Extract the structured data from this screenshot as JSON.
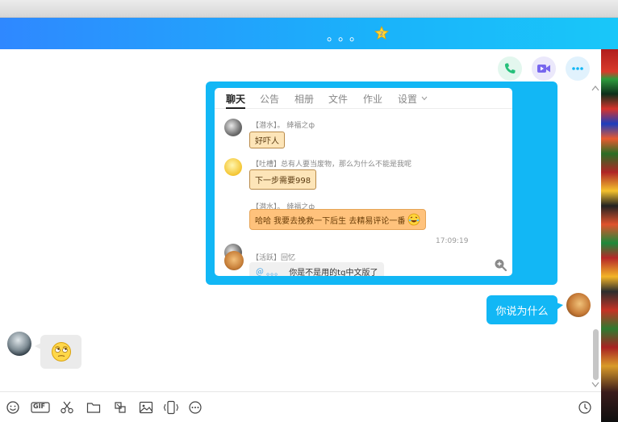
{
  "window": {
    "title": "。。。",
    "title_icon": "star-badge-icon",
    "accent": "#12b7f5",
    "titlebar_gradient": [
      "#2f88ff",
      "#19c7f9"
    ]
  },
  "header_actions": [
    {
      "name": "phone-call-button",
      "icon": "phone-icon",
      "color": "#27c07b"
    },
    {
      "name": "video-call-button",
      "icon": "video-camera-icon",
      "color": "#7766ee"
    },
    {
      "name": "more-options-button",
      "icon": "more-dots-icon",
      "color": "#12b7f5"
    }
  ],
  "shared_screenshot": {
    "tabs": [
      "聊天",
      "公告",
      "相册",
      "文件",
      "作业",
      "设置"
    ],
    "active_tab": "聊天",
    "messages": [
      {
        "sender": "【潜水】。 緈福之ф",
        "text": "好吓人",
        "style": "frame"
      },
      {
        "sender": "【吐槽】总有人要当废物，那么为什么不能是我呢",
        "text": "下一步需要998",
        "style": "frame"
      },
      {
        "sender": "【潜水】。 緈福之ф",
        "text": "哈哈  我要去挽救一下后生 去精易评论一番",
        "style": "orange"
      },
      {
        "sender": "【活跃】回忆",
        "text": "你是不是用的tg中文版了",
        "mention": "＠ 。。。",
        "style": "grey"
      }
    ],
    "timestamp": "17:09:19",
    "zoom_icon": "zoom-in-icon"
  },
  "outgoing_message": {
    "text": "你说为什么"
  },
  "incoming_message": {
    "content": "eye-roll-emoji"
  },
  "toolbar": [
    {
      "name": "emoji-button",
      "icon": "smile-icon"
    },
    {
      "name": "gif-button",
      "icon": "gif-icon",
      "label": "GIF"
    },
    {
      "name": "screenshot-button",
      "icon": "scissors-icon"
    },
    {
      "name": "file-button",
      "icon": "folder-icon"
    },
    {
      "name": "sticker-button",
      "icon": "sticker-icon"
    },
    {
      "name": "image-button",
      "icon": "image-icon"
    },
    {
      "name": "shake-button",
      "icon": "vibrate-icon"
    },
    {
      "name": "more-tools-button",
      "icon": "more-circle-icon"
    }
  ],
  "history_icon": "clock-icon"
}
